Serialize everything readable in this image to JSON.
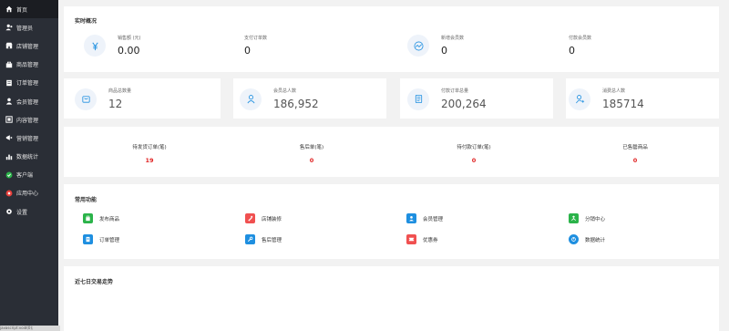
{
  "sidebar": {
    "items": [
      {
        "label": "首页",
        "icon": "home-icon"
      },
      {
        "label": "管理员",
        "icon": "admin-icon"
      },
      {
        "label": "店铺管理",
        "icon": "store-icon"
      },
      {
        "label": "商品管理",
        "icon": "goods-icon"
      },
      {
        "label": "订单管理",
        "icon": "order-icon"
      },
      {
        "label": "会员管理",
        "icon": "member-icon"
      },
      {
        "label": "内容管理",
        "icon": "content-icon"
      },
      {
        "label": "营销管理",
        "icon": "marketing-icon"
      },
      {
        "label": "数据统计",
        "icon": "stats-icon"
      },
      {
        "label": "客户端",
        "icon": "client-icon"
      },
      {
        "label": "应用中心",
        "icon": "app-center-icon"
      },
      {
        "label": "设置",
        "icon": "settings-icon"
      }
    ]
  },
  "realtime": {
    "title": "实时概况",
    "stats": [
      {
        "label": "销售额 (元)",
        "value": "0.00",
        "icon": "yen-icon"
      },
      {
        "label": "支付订单数",
        "value": "0"
      },
      {
        "label": "新增会员数",
        "value": "0",
        "icon": "trend-icon"
      },
      {
        "label": "付款会员数",
        "value": "0"
      }
    ]
  },
  "totals": [
    {
      "label": "商品总数量",
      "value": "12",
      "icon": "bag-icon"
    },
    {
      "label": "会员总人数",
      "value": "186,952",
      "icon": "user-icon"
    },
    {
      "label": "付款订单总量",
      "value": "200,264",
      "icon": "document-icon"
    },
    {
      "label": "消费总人数",
      "value": "185714",
      "icon": "user-add-icon"
    }
  ],
  "orders": [
    {
      "label": "待发货订单(笔)",
      "value": "19"
    },
    {
      "label": "售后单(笔)",
      "value": "0"
    },
    {
      "label": "待付款订单(笔)",
      "value": "0"
    },
    {
      "label": "已售罄商品",
      "value": "0"
    }
  ],
  "functions": {
    "title": "常用功能",
    "items": [
      {
        "label": "发布商品",
        "color": "#2bb34a",
        "icon": "publish-icon"
      },
      {
        "label": "店铺装修",
        "color": "#f05050",
        "icon": "decorate-icon"
      },
      {
        "label": "会员管理",
        "color": "#1e8fe0",
        "icon": "member-icon"
      },
      {
        "label": "分销中心",
        "color": "#2bb34a",
        "icon": "distribution-icon"
      },
      {
        "label": "订单管理",
        "color": "#1e8fe0",
        "icon": "order-icon"
      },
      {
        "label": "售后管理",
        "color": "#1e8fe0",
        "icon": "wrench-icon"
      },
      {
        "label": "优惠券",
        "color": "#f05050",
        "icon": "coupon-icon"
      },
      {
        "label": "数据统计",
        "color": "#1e8fe0",
        "icon": "stats-icon"
      }
    ]
  },
  "trend": {
    "title": "近七日交易走势"
  },
  "statusbar": {
    "text": "javascript:void(0);"
  }
}
